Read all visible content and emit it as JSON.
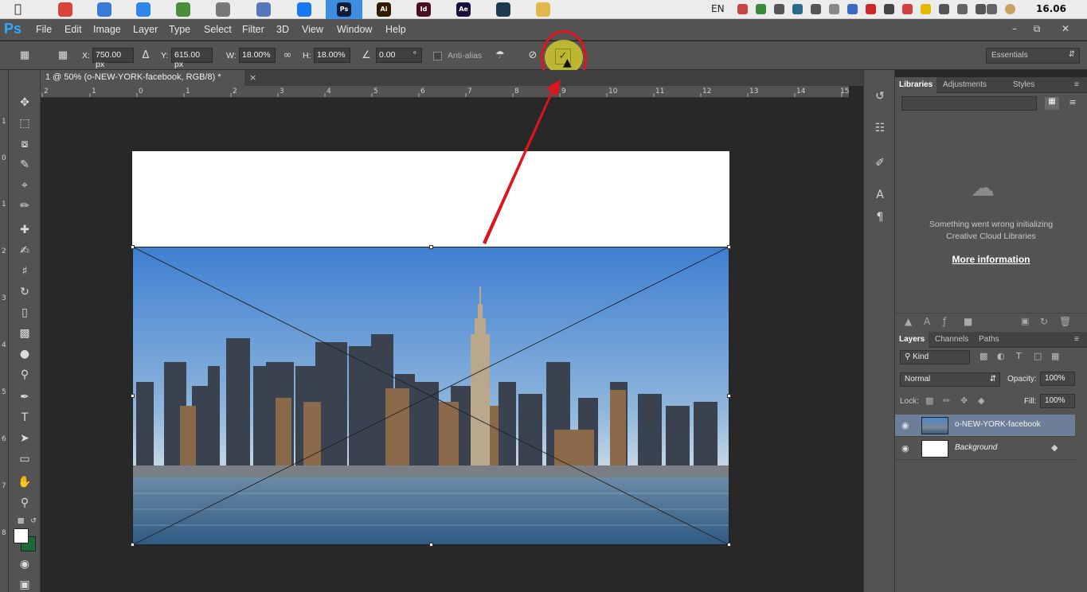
{
  "mac_menubar": {
    "apple": "",
    "dock_apps": [
      {
        "icon": "chrome-icon",
        "label": "",
        "color": "#d9433a"
      },
      {
        "icon": "video-icon",
        "label": "",
        "color": "#3b7bd8"
      },
      {
        "icon": "play-icon",
        "label": "",
        "color": "#2f86e8"
      },
      {
        "icon": "globe-icon",
        "label": "",
        "color": "#4a8d3a"
      },
      {
        "icon": "camera-icon",
        "label": "",
        "color": "#777777"
      },
      {
        "icon": "remote-icon",
        "label": "",
        "color": "#5777bb"
      },
      {
        "icon": "messenger-icon",
        "label": "",
        "color": "#1877f2"
      },
      {
        "icon": "photoshop-app-icon",
        "label": "Ps",
        "color": "#0c1c3a"
      },
      {
        "icon": "illustrator-app-icon",
        "label": "Ai",
        "color": "#331c00"
      },
      {
        "icon": "indesign-app-icon",
        "label": "Id",
        "color": "#4a0d24"
      },
      {
        "icon": "aftereffects-app-icon",
        "label": "Ae",
        "color": "#1b0e3d"
      },
      {
        "icon": "terminal-app-icon",
        "label": "",
        "color": "#1e3a4e"
      },
      {
        "icon": "folder-icon",
        "label": "",
        "color": "#e0b94a"
      }
    ],
    "language": "EN",
    "clock": "16.06"
  },
  "menubar": {
    "logo": "Ps",
    "items": [
      "File",
      "Edit",
      "Image",
      "Layer",
      "Type",
      "Select",
      "Filter",
      "3D",
      "View",
      "Window",
      "Help"
    ]
  },
  "options_bar": {
    "x_label": "X:",
    "x_value": "750.00 px",
    "y_label": "Y:",
    "y_value": "615.00 px",
    "w_label": "W:",
    "w_value": "18.00%",
    "h_label": "H:",
    "h_value": "18.00%",
    "angle_value": "0.00",
    "angle_unit": "°",
    "antialias_label": "Anti-alias",
    "workspace": "Essentials"
  },
  "document": {
    "tab_title": "1 @ 50% (o-NEW-YORK-facebook, RGB/8) *",
    "close": "×"
  },
  "ruler_top_ticks": [
    "2",
    "1",
    "0",
    "1",
    "2",
    "3",
    "4",
    "5",
    "6",
    "7",
    "8",
    "9",
    "10",
    "11",
    "12",
    "13",
    "14",
    "15"
  ],
  "ruler_left_ticks": [
    "1",
    "0",
    "1",
    "2",
    "3",
    "4",
    "5",
    "6",
    "7",
    "8"
  ],
  "libraries_panel": {
    "tabs": [
      "Libraries",
      "Adjustments",
      "Styles"
    ],
    "message_line1": "Something went wrong initializing",
    "message_line2": "Creative Cloud Libraries",
    "link": "More information"
  },
  "layers_panel": {
    "tabs": [
      "Layers",
      "Channels",
      "Paths"
    ],
    "filter": "Kind",
    "blend_mode": "Normal",
    "opacity_label": "Opacity:",
    "opacity_value": "100%",
    "lock_label": "Lock:",
    "fill_label": "Fill:",
    "fill_value": "100%",
    "layers": [
      {
        "name": "o-NEW-YORK-facebook",
        "selected": true
      },
      {
        "name": "Background",
        "selected": false
      }
    ]
  },
  "colors": {
    "accent": "#31a8ff",
    "annotation": "#e0141c",
    "highlight": "#c9c130"
  }
}
